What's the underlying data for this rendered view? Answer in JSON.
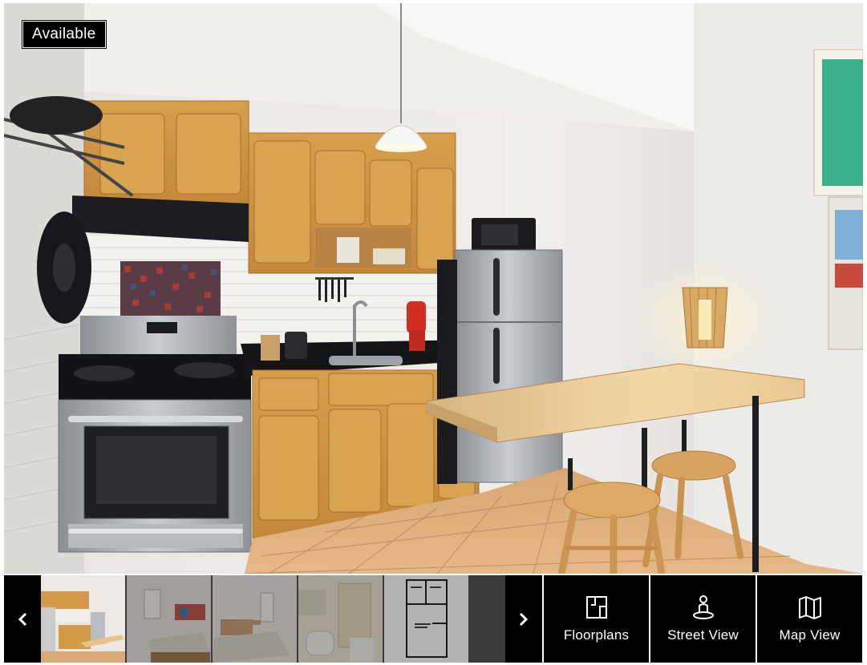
{
  "listing": {
    "status_badge": "Available",
    "main_photo_icon": "kitchen-photo"
  },
  "gallery": {
    "prev_icon": "chevron-left-icon",
    "next_icon": "chevron-right-icon",
    "thumbnails": [
      {
        "subject": "kitchen"
      },
      {
        "subject": "bedroom"
      },
      {
        "subject": "bedroom"
      },
      {
        "subject": "bathroom"
      },
      {
        "subject": "floorplan"
      }
    ]
  },
  "actions": {
    "floorplans_label": "Floorplans",
    "floorplans_icon": "floorplan-icon",
    "street_view_label": "Street View",
    "street_view_icon": "street-view-person-icon",
    "map_view_label": "Map View",
    "map_view_icon": "folded-map-icon"
  },
  "colors": {
    "badge_bg": "#000000",
    "badge_text": "#ffffff",
    "action_bg": "#000000",
    "action_text": "#ffffff"
  }
}
